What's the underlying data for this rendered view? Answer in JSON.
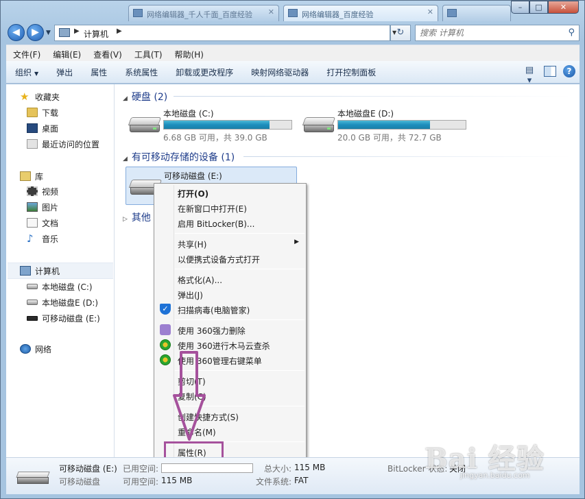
{
  "titlebar": {
    "tabs": [
      "网络编辑器_千人千面_百度经验",
      "网络编辑器_百度经验",
      "",
      ""
    ],
    "minimize": "–",
    "maximize": "□",
    "close": "✕"
  },
  "address": {
    "back": "◀",
    "forward": "▶",
    "crumb": "计算机",
    "search_placeholder": "搜索 计算机"
  },
  "menubar": [
    "文件(F)",
    "编辑(E)",
    "查看(V)",
    "工具(T)",
    "帮助(H)"
  ],
  "commandbar": [
    "组织",
    "弹出",
    "属性",
    "系统属性",
    "卸载或更改程序",
    "映射网络驱动器",
    "打开控制面板"
  ],
  "nav": {
    "favorites": "收藏夹",
    "downloads": "下载",
    "desktop": "桌面",
    "recent": "最近访问的位置",
    "libraries": "库",
    "videos": "视频",
    "pictures": "图片",
    "documents": "文档",
    "music": "音乐",
    "computer": "计算机",
    "drive_c": "本地磁盘 (C:)",
    "drive_d": "本地磁盘E (D:)",
    "drive_e": "可移动磁盘 (E:)",
    "network": "网络"
  },
  "groups": {
    "hdd": "硬盘 (2)",
    "removable": "有可移动存储的设备 (1)",
    "other": "其他"
  },
  "drives": {
    "c": {
      "name": "本地磁盘 (C:)",
      "free": "6.68 GB 可用，共 39.0 GB",
      "used_fraction": 0.83
    },
    "d": {
      "name": "本地磁盘E (D:)",
      "free": "20.0 GB 可用，共 72.7 GB",
      "used_fraction": 0.72
    },
    "e": {
      "name": "可移动磁盘 (E:)"
    }
  },
  "context_menu": {
    "open": "打开(O)",
    "open_new": "在新窗口中打开(E)",
    "bitlocker": "启用 BitLocker(B)...",
    "share": "共享(H)",
    "portable": "以便携式设备方式打开",
    "format": "格式化(A)...",
    "eject": "弹出(J)",
    "scan": "扫描病毒(电脑管家)",
    "del360": "使用 360强力删除",
    "scan360": "使用 360进行木马云查杀",
    "menu360": "使用 360管理右键菜单",
    "cut": "剪切(T)",
    "copy": "复制(C)",
    "shortcut": "创建快捷方式(S)",
    "rename": "重命名(M)",
    "properties": "属性(R)"
  },
  "details": {
    "name": "可移动磁盘 (E:)",
    "type": "可移动磁盘",
    "used_label": "已用空间:",
    "free_label": "可用空间:",
    "free_value": "115 MB",
    "total_label": "总大小:",
    "total_value": "115 MB",
    "fs_label": "文件系统:",
    "fs_value": "FAT",
    "bitlocker_label": "BitLocker 状态:",
    "bitlocker_value": "关闭"
  },
  "watermark": {
    "logo": "Bai 经验",
    "url": "jingyan.baidu.com"
  },
  "colors": {
    "accent": "#1e3c8a",
    "annotation": "#a5519c",
    "bar_fill": "#1d8ebd"
  }
}
